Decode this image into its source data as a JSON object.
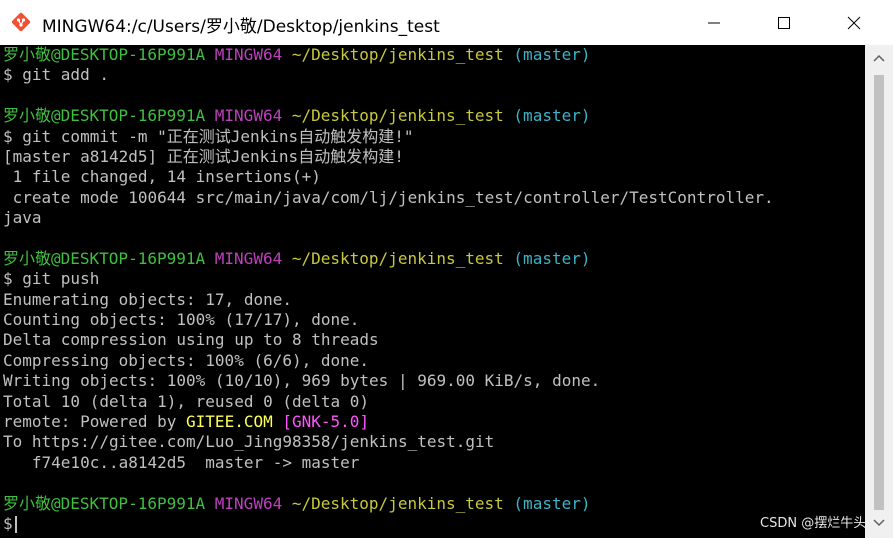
{
  "window": {
    "title": "MINGW64:/c/Users/罗小敬/Desktop/jenkins_test",
    "icon": "git-icon",
    "controls": [
      "minimize-icon",
      "maximize-icon",
      "close-icon"
    ]
  },
  "colors": {
    "background": "#000000",
    "text": "#c0c0c0",
    "user_host": "#3fbf3f",
    "msystem": "#bf3fbf",
    "path": "#c8c83c",
    "branch": "#3cb4c8",
    "git_icon": "#f05033"
  },
  "terminal": {
    "prompt": {
      "user_host": "罗小敬@DESKTOP-16P991A",
      "msystem": "MINGW64",
      "path": "~/Desktop/jenkins_test",
      "branch": "(master)",
      "symbol": "$"
    },
    "l2": "$ git add .",
    "l5": "$ git commit -m \"正在测试Jenkins自动触发构建!\"",
    "l6": "[master a8142d5] 正在测试Jenkins自动触发构建!",
    "l7": " 1 file changed, 14 insertions(+)",
    "l8": " create mode 100644 src/main/java/com/lj/jenkins_test/controller/TestController.",
    "l9": "java",
    "l12": "$ git push",
    "l13": "Enumerating objects: 17, done.",
    "l14": "Counting objects: 100% (17/17), done.",
    "l15": "Delta compression using up to 8 threads",
    "l16": "Compressing objects: 100% (6/6), done.",
    "l17": "Writing objects: 100% (10/10), 969 bytes | 969.00 KiB/s, done.",
    "l18": "Total 10 (delta 1), reused 0 (delta 0)",
    "l19_prefix": "remote: Powered by ",
    "l19_gitee": "GITEE.COM",
    "l19_space": " ",
    "l19_gnk": "[GNK-5.0]",
    "l20": "To https://gitee.com/Luo_Jing98358/jenkins_test.git",
    "l21": "   f74e10c..a8142d5  master -> master",
    "l24": "$ "
  },
  "watermark": "CSDN @摆烂牛头"
}
